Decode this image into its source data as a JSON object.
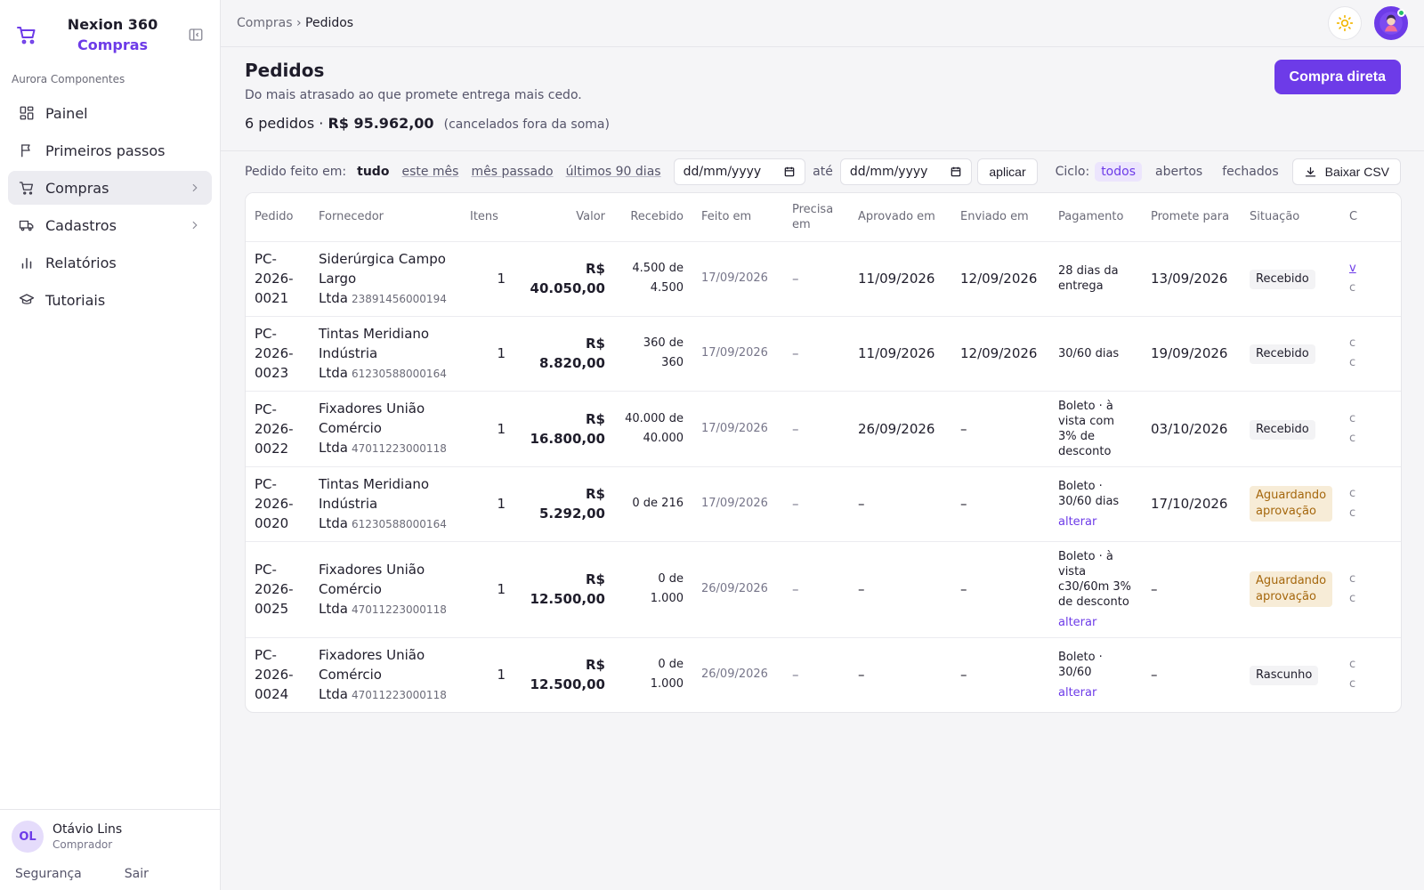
{
  "brand": {
    "name": "Nexion 360",
    "module": "Compras"
  },
  "org": "Aurora Componentes",
  "nav": [
    {
      "label": "Painel",
      "icon": "grid-icon",
      "active": false,
      "submenu": false
    },
    {
      "label": "Primeiros passos",
      "icon": "flag-icon",
      "active": false,
      "submenu": false
    },
    {
      "label": "Compras",
      "icon": "cart-icon",
      "active": true,
      "submenu": true
    },
    {
      "label": "Cadastros",
      "icon": "truck-icon",
      "active": false,
      "submenu": true
    },
    {
      "label": "Relatórios",
      "icon": "bar-chart-icon",
      "active": false,
      "submenu": false
    },
    {
      "label": "Tutoriais",
      "icon": "graduation-cap-icon",
      "active": false,
      "submenu": false
    }
  ],
  "user": {
    "initials": "OL",
    "name": "Otávio Lins",
    "role": "Comprador",
    "security": "Segurança",
    "logout": "Sair"
  },
  "breadcrumb": {
    "parent": "Compras",
    "sep": "›",
    "current": "Pedidos"
  },
  "page": {
    "title": "Pedidos",
    "subtitle": "Do mais atrasado ao que promete entrega mais cedo.",
    "count": "6 pedidos",
    "sep": "·",
    "total": "R$ 95.962,00",
    "note": "(cancelados fora da soma)",
    "cta": "Compra direta"
  },
  "filters": {
    "label": "Pedido feito em:",
    "options": [
      "tudo",
      "este mês",
      "mês passado",
      "últimos 90 dias"
    ],
    "selected": "tudo",
    "date_from": "dd/mm/yyyy",
    "ate": "até",
    "date_to": "dd/mm/yyyy",
    "apply": "aplicar",
    "ciclo_label": "Ciclo:",
    "ciclo_options": [
      "todos",
      "abertos",
      "fechados"
    ],
    "ciclo_selected": "todos",
    "csv": "Baixar CSV"
  },
  "table": {
    "headers": [
      "Pedido",
      "Fornecedor",
      "Itens",
      "Valor",
      "Recebido",
      "Feito em",
      "Precisa em",
      "Aprovado em",
      "Enviado em",
      "Pagamento",
      "Promete para",
      "Situação",
      "C"
    ],
    "rows": [
      {
        "pedido": "PC-2026-0021",
        "fornecedor": "Siderúrgica Campo Largo Ltda",
        "cnpj": "23891456000194",
        "itens": "1",
        "valor": "R$ 40.050,00",
        "recebido": "4.500 de 4.500",
        "feito": "17/09/2026",
        "precisa": "–",
        "aprovado": "11/09/2026",
        "enviado": "12/09/2026",
        "pagamento": "28 dias da entrega",
        "alterar": "",
        "promete": "13/09/2026",
        "situacao": "Recebido",
        "status": "ok",
        "extra": "v",
        "extra2": "c"
      },
      {
        "pedido": "PC-2026-0023",
        "fornecedor": "Tintas Meridiano Indústria Ltda",
        "cnpj": "61230588000164",
        "itens": "1",
        "valor": "R$ 8.820,00",
        "recebido": "360 de 360",
        "feito": "17/09/2026",
        "precisa": "–",
        "aprovado": "11/09/2026",
        "enviado": "12/09/2026",
        "pagamento": "30/60 dias",
        "alterar": "",
        "promete": "19/09/2026",
        "situacao": "Recebido",
        "status": "ok",
        "extra": "c",
        "extra2": "c"
      },
      {
        "pedido": "PC-2026-0022",
        "fornecedor": "Fixadores União Comércio Ltda",
        "cnpj": "47011223000118",
        "itens": "1",
        "valor": "R$ 16.800,00",
        "recebido": "40.000 de 40.000",
        "feito": "17/09/2026",
        "precisa": "–",
        "aprovado": "26/09/2026",
        "enviado": "–",
        "pagamento": "Boleto · à vista com 3% de desconto",
        "alterar": "",
        "promete": "03/10/2026",
        "situacao": "Recebido",
        "status": "ok",
        "extra": "c",
        "extra2": "c"
      },
      {
        "pedido": "PC-2026-0020",
        "fornecedor": "Tintas Meridiano Indústria Ltda",
        "cnpj": "61230588000164",
        "itens": "1",
        "valor": "R$ 5.292,00",
        "recebido": "0 de 216",
        "feito": "17/09/2026",
        "precisa": "–",
        "aprovado": "–",
        "enviado": "–",
        "pagamento": "Boleto · 30/60 dias",
        "alterar": "alterar",
        "promete": "17/10/2026",
        "situacao": "Aguardando aprovação",
        "status": "wait",
        "extra": "c",
        "extra2": "c"
      },
      {
        "pedido": "PC-2026-0025",
        "fornecedor": "Fixadores União Comércio Ltda",
        "cnpj": "47011223000118",
        "itens": "1",
        "valor": "R$ 12.500,00",
        "recebido": "0 de 1.000",
        "feito": "26/09/2026",
        "precisa": "–",
        "aprovado": "–",
        "enviado": "–",
        "pagamento": "Boleto · à vista c30/60m 3% de desconto",
        "alterar": "alterar",
        "promete": "–",
        "situacao": "Aguardando aprovação",
        "status": "wait",
        "extra": "c",
        "extra2": "c"
      },
      {
        "pedido": "PC-2026-0024",
        "fornecedor": "Fixadores União Comércio Ltda",
        "cnpj": "47011223000118",
        "itens": "1",
        "valor": "R$ 12.500,00",
        "recebido": "0 de 1.000",
        "feito": "26/09/2026",
        "precisa": "–",
        "aprovado": "–",
        "enviado": "–",
        "pagamento": "Boleto · 30/60",
        "alterar": "alterar",
        "promete": "–",
        "situacao": "Rascunho",
        "status": "draft",
        "extra": "c",
        "extra2": "c"
      }
    ]
  },
  "colors": {
    "accent": "#6d3be8",
    "waiting_bg": "#f7ecd7",
    "waiting_text": "#a5670d",
    "online": "#22c06a",
    "sun": "#f2b705"
  }
}
